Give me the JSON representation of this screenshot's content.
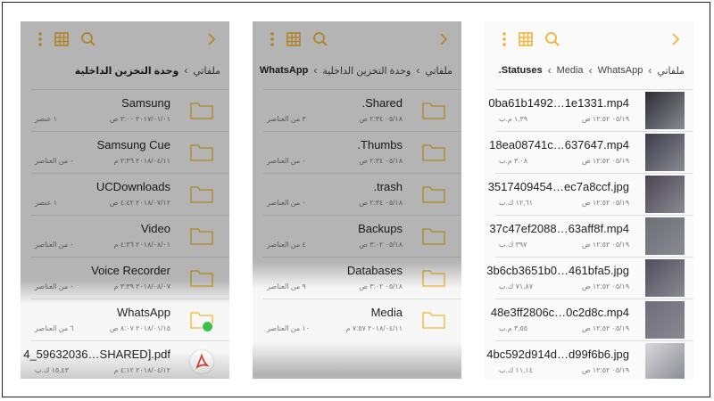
{
  "colors": {
    "accent": "#f1b335",
    "folder": "#f1c24e",
    "pdf": "#e0362c",
    "whatsapp": "#3cc24b"
  },
  "icons": {
    "menu": "kebab-icon",
    "view": "grid-icon",
    "search": "search-icon",
    "back": "chevron-right-icon"
  },
  "panel1": {
    "breadcrumb": {
      "root": "ملفاتي",
      "current": "وحدة التخزين الداخلية"
    },
    "items": [
      {
        "name": "Samsung",
        "date": "٢٠١٧/٠١/٠١ ٣:٠٠ ص",
        "meta": "١ عنصر",
        "type": "folder"
      },
      {
        "name": "Samsung Cue",
        "date": "٢٠١٨/٠٤/١١ ٢:٣٦ م",
        "meta": "٠ من العناصر",
        "type": "folder"
      },
      {
        "name": "UCDownloads",
        "date": "٢٠١٨/٠٧/١٢ ٤:٤٢ ص",
        "meta": "١ عنصر",
        "type": "folder"
      },
      {
        "name": "Video",
        "date": "٢٠١٨/٠٨/٠١ ٤:٣٦ م",
        "meta": "٠ من العناصر",
        "type": "folder"
      },
      {
        "name": "Voice Recorder",
        "date": "٢٠١٨/٠٨/٠٧ ٣:٣٩ م",
        "meta": "٠ من العناصر",
        "type": "folder"
      },
      {
        "name": "WhatsApp",
        "date": "٢٠١٨/٠١/١٥ ٨:٠٧ ص",
        "meta": "٦ من العناصر",
        "type": "whatsapp"
      },
      {
        "name": "4_59632036…SHARED].pdf",
        "date": "٢٠١٨/٠٤/١٢ ٤:١٢ م",
        "meta": "١٥,٤٣ ك.ب",
        "type": "pdf"
      }
    ]
  },
  "panel2": {
    "breadcrumb": {
      "root": "ملفاتي",
      "middle": "وحدة التخزين الداخلية",
      "current": "WhatsApp"
    },
    "items": [
      {
        "name": ".Shared",
        "date": "٠٥/١٨ ٢:٣٤ ص",
        "meta": "٣ من العناصر"
      },
      {
        "name": ".Thumbs",
        "date": "٠٥/١٨ ٢:٣٤ ص",
        "meta": "٠ من العناصر"
      },
      {
        "name": ".trash",
        "date": "٠٥/١٨ ٢:٣٤ ص",
        "meta": "٠ من العناصر"
      },
      {
        "name": "Backups",
        "date": "٠٥/١٨ ٣:٠٢ ص",
        "meta": "٤ من العناصر"
      },
      {
        "name": "Databases",
        "date": "٠٥/١٨ ٣:٠٢ ص",
        "meta": "٩ من العناصر"
      },
      {
        "name": "Media",
        "date": "٢٠١٨/٠٤/١١ ٧:٥٧ م",
        "meta": "١٠ من العناصر"
      }
    ]
  },
  "panel3": {
    "breadcrumb": {
      "root": "ملفاتي",
      "a": "WhatsApp",
      "b": "Media",
      "current": ".Statuses"
    },
    "items": [
      {
        "name": "0ba61b1492…1e1331.mp4",
        "date": "٠٥/١٩ ١٢:٥٢ ص",
        "meta": "١,٣٩ م.ب",
        "shade": "#2c2c32"
      },
      {
        "name": "18ea08741c…637647.mp4",
        "date": "٠٥/١٩ ١٢:٥٢ ص",
        "meta": "٣.٠٨ م.ب",
        "shade": "#3b3d4a"
      },
      {
        "name": "3517409454…ec7a8ccf.jpg",
        "date": "٠٥/١٩ ١٢:٥٢ ص",
        "meta": "١٢,٦١ ك.ب",
        "shade": "#4a4552"
      },
      {
        "name": "37c47ef2088…63aff8f.mp4",
        "date": "٠٥/١٩ ١٢:٥٢ ص",
        "meta": "٣٩٧ ك.ب",
        "shade": "#6d6f75"
      },
      {
        "name": "3b6cb3651b0…461bfa5.jpg",
        "date": "٠٥/١٩ ١٢:٥٢ ص",
        "meta": "٧١,٨٧ ك.ب",
        "shade": "#4f4d5c"
      },
      {
        "name": "48e3ff2806c…0c2d8c.mp4",
        "date": "٠٥/١٩ ١٢:٥٢ ص",
        "meta": "٣,٥٥ م.ب",
        "shade": "#6e6b78"
      },
      {
        "name": "4bc592d914d…d99f6b6.jpg",
        "date": "٠٥/١٩ ١٢:٥٢ ص",
        "meta": "١١,١٤ ك.ب",
        "shade": "#d8d8dc"
      }
    ]
  }
}
